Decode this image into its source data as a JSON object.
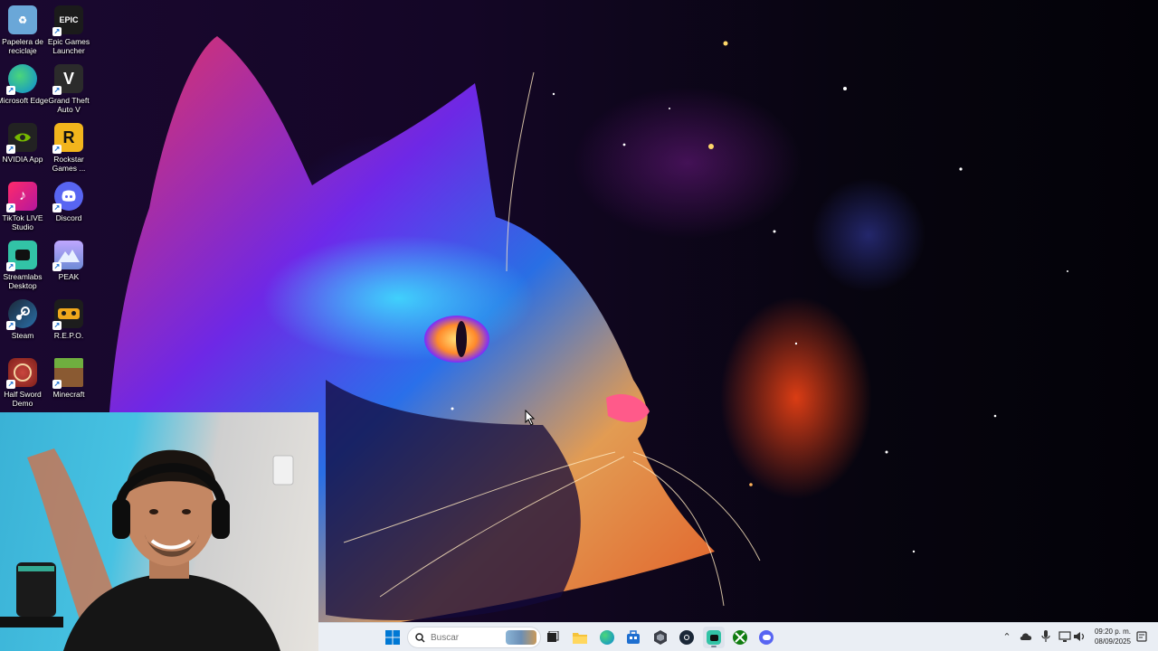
{
  "desktop": {
    "icons": [
      {
        "label": "Papelera de reciclaje",
        "icon": "recycle-bin-icon",
        "color": "#6aa7d8"
      },
      {
        "label": "Epic Games Launcher",
        "icon": "epic-games-icon",
        "color": "#1b1b1b",
        "glyph": "EPIC"
      },
      {
        "label": "Microsoft Edge",
        "icon": "edge-icon",
        "color": "#0c8bd6"
      },
      {
        "label": "Grand Theft Auto V",
        "icon": "gta-v-icon",
        "color": "#2b2b2b",
        "glyph": "V"
      },
      {
        "label": "NVIDIA App",
        "icon": "nvidia-icon",
        "color": "#222222"
      },
      {
        "label": "Rockstar Games ...",
        "icon": "rockstar-icon",
        "color": "#f2b51c",
        "glyph": "R"
      },
      {
        "label": "TikTok LIVE Studio",
        "icon": "tiktok-icon",
        "color": "#e82a5a"
      },
      {
        "label": "Discord",
        "icon": "discord-icon",
        "color": "#5865f2"
      },
      {
        "label": "Streamlabs Desktop",
        "icon": "streamlabs-icon",
        "color": "#32c3a6"
      },
      {
        "label": "PEAK",
        "icon": "peak-icon",
        "color": "#9b8ad0"
      },
      {
        "label": "Steam",
        "icon": "steam-icon",
        "color": "#1b2838"
      },
      {
        "label": "R.E.P.O.",
        "icon": "repo-icon",
        "color": "#f0a81c"
      },
      {
        "label": "Half Sword Demo",
        "icon": "half-sword-icon",
        "color": "#a82f28"
      },
      {
        "label": "Minecraft",
        "icon": "minecraft-icon",
        "color": "#5c8d3a"
      }
    ]
  },
  "taskbar": {
    "search_placeholder": "Buscar",
    "apps": [
      {
        "name": "start",
        "icon": "windows-start-icon"
      },
      {
        "name": "widgets",
        "icon": "widgets-icon"
      },
      {
        "name": "task-view",
        "icon": "task-view-icon"
      },
      {
        "name": "file-explorer",
        "icon": "folder-icon"
      },
      {
        "name": "edge",
        "icon": "edge-icon"
      },
      {
        "name": "store",
        "icon": "store-icon"
      },
      {
        "name": "app",
        "icon": "hexagon-app-icon"
      },
      {
        "name": "steam",
        "icon": "steam-icon"
      },
      {
        "name": "streamlabs",
        "icon": "streamlabs-icon"
      },
      {
        "name": "xbox",
        "icon": "xbox-icon"
      },
      {
        "name": "discord",
        "icon": "discord-icon"
      }
    ],
    "tray": [
      "chevron-up-icon",
      "onedrive-icon",
      "microphone-icon",
      "network-icon",
      "volume-icon",
      "notification-icon"
    ],
    "clock": {
      "time": "09:20 p. m.",
      "date": "08/09/2025"
    }
  },
  "colors": {
    "taskbar_bg": "#eaeef4",
    "accent": "#0078d4"
  }
}
